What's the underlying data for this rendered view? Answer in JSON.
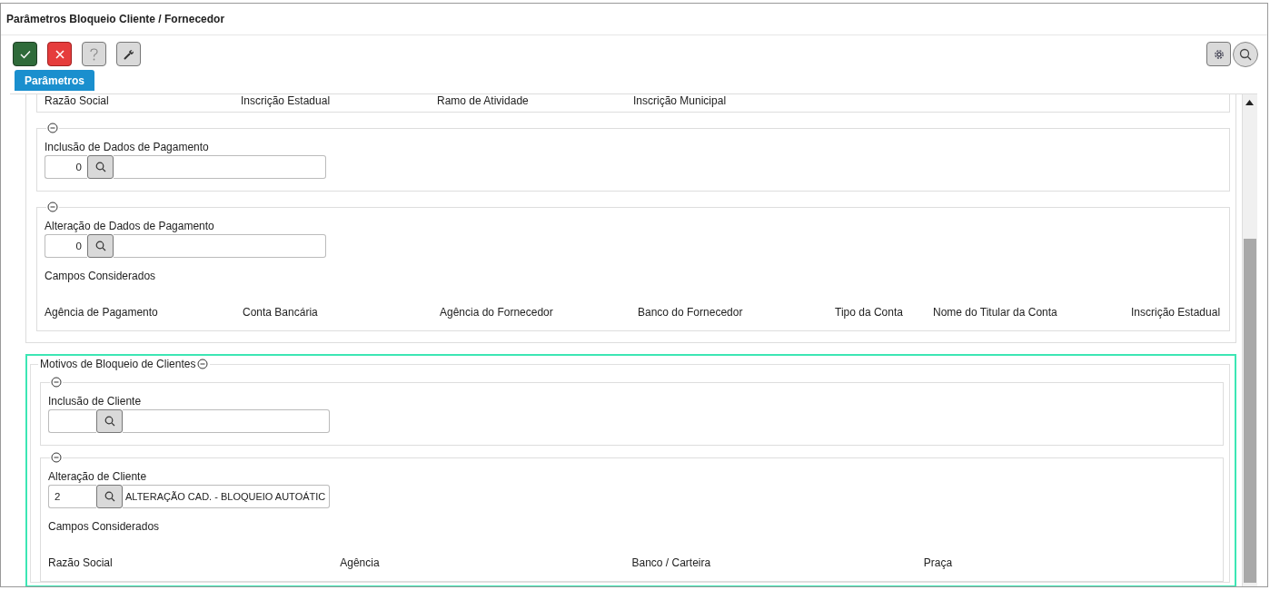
{
  "window": {
    "title": "Parâmetros Bloqueio Cliente / Fornecedor"
  },
  "tabs": [
    {
      "label": "Parâmetros",
      "selected": true
    }
  ],
  "supplier_section": {
    "top_fields": [
      "Razão Social",
      "Inscrição Estadual",
      "Ramo de Atividade",
      "Inscrição Municipal"
    ],
    "groups": [
      {
        "label": "Inclusão de Dados de Pagamento",
        "expanded": true,
        "code": "0"
      },
      {
        "label": "Alteração de Dados de Pagamento",
        "expanded": true,
        "code": "0",
        "fields_title": "Campos Considerados",
        "fields": [
          "Agência de Pagamento",
          "Conta Bancária",
          "Agência do Fornecedor",
          "Banco do Fornecedor",
          "Tipo da Conta",
          "Nome do Titular da Conta",
          "Inscrição Estadual"
        ]
      }
    ]
  },
  "client_section": {
    "title": "Motivos de Bloqueio de Clientes",
    "expanded": true,
    "groups": [
      {
        "label": "Inclusão de Cliente",
        "expanded": true
      },
      {
        "label": "Alteração de Cliente",
        "expanded": true,
        "code": "2",
        "description": "ALTERAÇÃO CAD. - BLOQUEIO AUTOÁTIC",
        "fields_title": "Campos Considerados",
        "fields": [
          "Razão Social",
          "Agência",
          "Banco / Carteira",
          "Praça"
        ]
      }
    ]
  }
}
